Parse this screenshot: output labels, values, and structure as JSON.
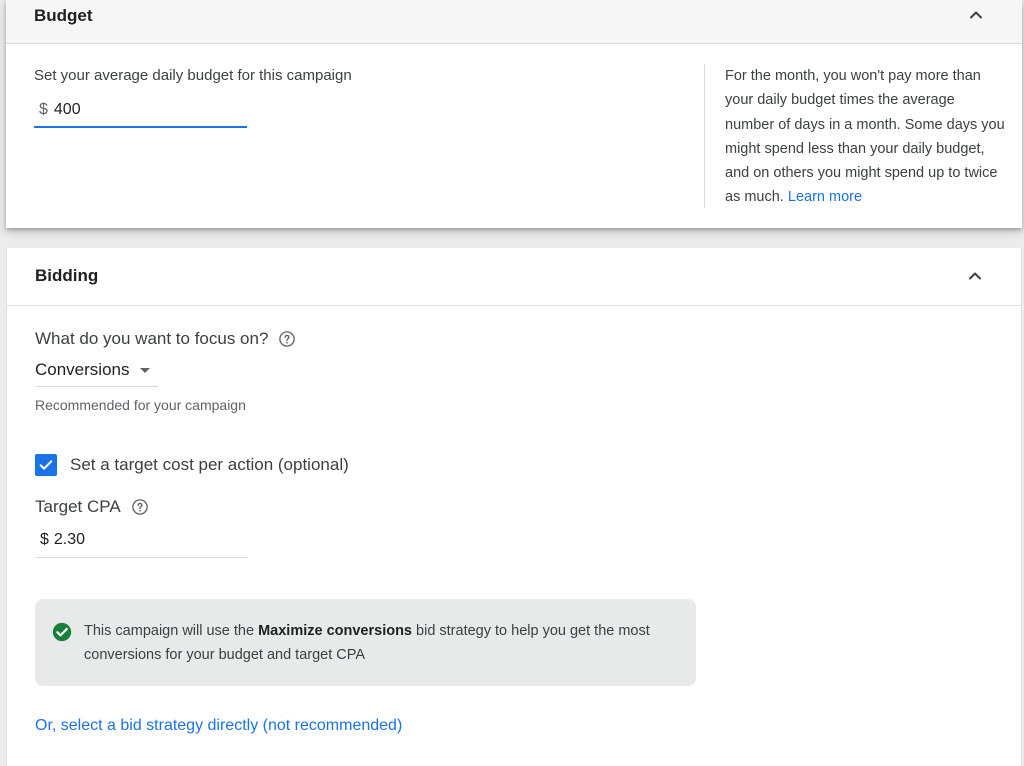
{
  "budget": {
    "title": "Budget",
    "label": "Set your average daily budget for this campaign",
    "currency_symbol": "$",
    "amount": "400",
    "help_text": "For the month, you won't pay more than your daily budget times the average number of days in a month. Some days you might spend less than your daily budget, and on others you might spend up to twice as much.",
    "learn_more": "Learn more"
  },
  "bidding": {
    "title": "Bidding",
    "focus_question": "What do you want to focus on?",
    "focus_value": "Conversions",
    "recommended_note": "Recommended for your campaign",
    "target_cpa_checkbox_label": "Set a target cost per action (optional)",
    "target_cpa_checked": true,
    "target_cpa_label": "Target CPA",
    "target_cpa_currency": "$",
    "target_cpa_value": "2.30",
    "info": {
      "prefix": "This campaign will use the ",
      "strategy": "Maximize conversions",
      "suffix": " bid strategy to help you get the most conversions for your budget and target CPA"
    },
    "select_directly_link": "Or, select a bid strategy directly (not recommended)"
  },
  "icons": {
    "collapse": "chevron-up-icon",
    "help": "help-circle-icon",
    "check": "check-icon",
    "info_check": "check-circle-icon"
  },
  "colors": {
    "accent": "#1a73e8",
    "success": "#188038"
  }
}
